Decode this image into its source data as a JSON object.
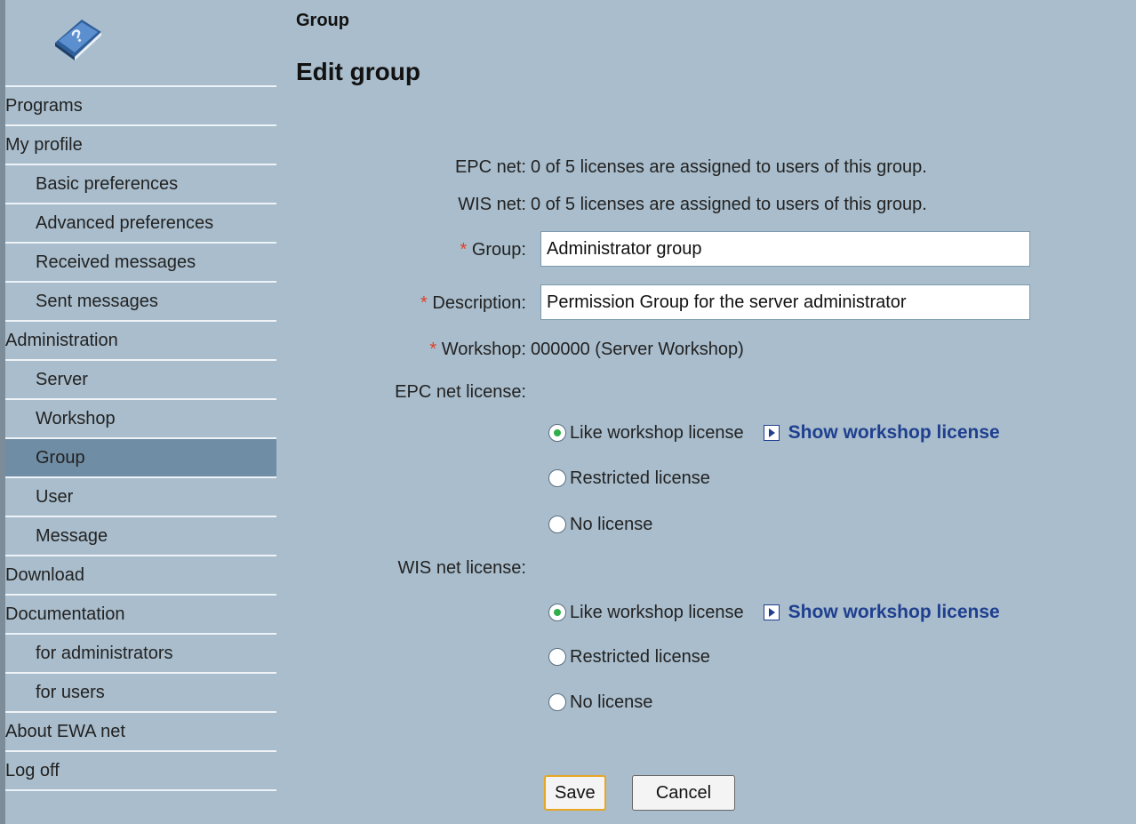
{
  "sidebar": {
    "items": [
      {
        "label": "Programs",
        "level": 0
      },
      {
        "label": "My profile",
        "level": 0
      },
      {
        "label": "Basic preferences",
        "level": 1
      },
      {
        "label": "Advanced preferences",
        "level": 1
      },
      {
        "label": "Received messages",
        "level": 1
      },
      {
        "label": "Sent messages",
        "level": 1
      },
      {
        "label": "Administration",
        "level": 0
      },
      {
        "label": "Server",
        "level": 1
      },
      {
        "label": "Workshop",
        "level": 1
      },
      {
        "label": "Group",
        "level": 1,
        "active": true
      },
      {
        "label": "User",
        "level": 1
      },
      {
        "label": "Message",
        "level": 1
      },
      {
        "label": "Download",
        "level": 0
      },
      {
        "label": "Documentation",
        "level": 0
      },
      {
        "label": "for administrators",
        "level": 1
      },
      {
        "label": "for users",
        "level": 1
      },
      {
        "label": "About EWA net",
        "level": 0
      },
      {
        "label": "Log off",
        "level": 0
      }
    ]
  },
  "header": {
    "breadcrumb": "Group",
    "title": "Edit group"
  },
  "form": {
    "epc_net_label": "EPC net:",
    "epc_net_value": "0 of 5 licenses are assigned to users of this group.",
    "wis_net_label": "WIS net:",
    "wis_net_value": "0 of 5 licenses are assigned to users of this group.",
    "required_mark": "*",
    "group_label": "Group:",
    "group_value": "Administrator group",
    "description_label": "Description:",
    "description_value": "Permission Group for the server administrator",
    "workshop_label": "Workshop:",
    "workshop_value": "000000 (Server Workshop)",
    "epc_license_label": "EPC net license:",
    "wis_license_label": "WIS net license:",
    "epc_options": {
      "like_workshop": "Like workshop license",
      "restricted": "Restricted license",
      "none": "No license",
      "selected": "like_workshop"
    },
    "wis_options": {
      "like_workshop": "Like workshop license",
      "restricted": "Restricted license",
      "none": "No license",
      "selected": "like_workshop"
    },
    "show_workshop_link": "Show workshop license",
    "save_label": "Save",
    "cancel_label": "Cancel"
  },
  "colors": {
    "background": "#a9bdcc",
    "active_nav": "#6f8da4",
    "required": "#e0402a",
    "link": "#1f3f8f",
    "radio_selected": "#2fb04a"
  },
  "icons": [
    "help-book-icon",
    "play-arrow-icon"
  ]
}
